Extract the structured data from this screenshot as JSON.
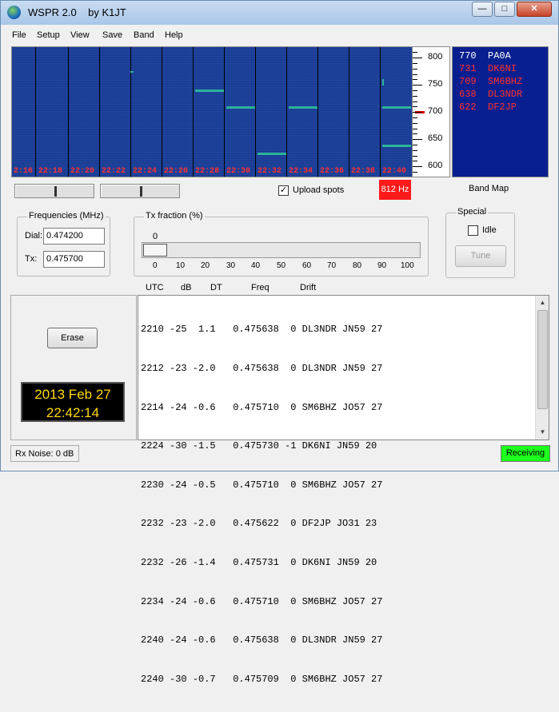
{
  "window": {
    "title": "WSPR 2.0",
    "author": "by K1JT",
    "buttons": {
      "minimize": "—",
      "maximize": "□",
      "close": "✕"
    }
  },
  "menu": [
    "File",
    "Setup",
    "View",
    "Save",
    "Band",
    "Help"
  ],
  "waterfall": {
    "times": [
      "2:16",
      "22:18",
      "22:20",
      "22:22",
      "22:24",
      "22:26",
      "22:28",
      "22:30",
      "22:32",
      "22:34",
      "22:36",
      "22:38",
      "22:40"
    ],
    "scale": {
      "ticks": [
        "800",
        "750",
        "700",
        "650",
        "600"
      ]
    },
    "signal_color": "#2fc89a",
    "marker_color": "#e00000"
  },
  "spots_panel": [
    {
      "text": "770  PA0A",
      "color": "#ffffff"
    },
    {
      "text": "731  DK6NI",
      "color": "#ff3030"
    },
    {
      "text": "709  SM6BHZ",
      "color": "#ff3030"
    },
    {
      "text": "638  DL3NDR",
      "color": "#ff3030"
    },
    {
      "text": "622  DF2JP",
      "color": "#ff3030"
    }
  ],
  "controls": {
    "upload_spots_label": "Upload spots",
    "upload_checked": "✓",
    "hz_readout": "812 Hz",
    "band_map": "Band Map"
  },
  "frequencies": {
    "title": "Frequencies (MHz)",
    "dial_label": "Dial:",
    "dial_value": "0.474200",
    "tx_label": "Tx:",
    "tx_value": "0.475700"
  },
  "tx_fraction": {
    "title": "Tx fraction (%)",
    "value": "0",
    "value_fraction": 0,
    "scale": [
      "0",
      "10",
      "20",
      "30",
      "40",
      "50",
      "60",
      "70",
      "80",
      "90",
      "100"
    ]
  },
  "special": {
    "title": "Special",
    "idle_label": "Idle",
    "tune_label": "Tune"
  },
  "erase_label": "Erase",
  "clock": {
    "date": "2013 Feb 27",
    "time": "22:42:14"
  },
  "log": {
    "headers": [
      "UTC",
      "dB",
      "DT",
      "Freq",
      "Drift"
    ],
    "lines": [
      "2210 -25  1.1   0.475638  0 DL3NDR JN59 27",
      "2212 -23 -2.0   0.475638  0 DL3NDR JN59 27",
      "2214 -24 -0.6   0.475710  0 SM6BHZ JO57 27",
      "2224 -30 -1.5   0.475730 -1 DK6NI JN59 20",
      "2230 -24 -0.5   0.475710  0 SM6BHZ JO57 27",
      "2232 -23 -2.0   0.475622  0 DF2JP JO31 23",
      "2232 -26 -1.4   0.475731  0 DK6NI JN59 20",
      "2234 -24 -0.6   0.475710  0 SM6BHZ JO57 27",
      "2240 -24 -0.6   0.475638  0 DL3NDR JN59 27",
      "2240 -30 -0.7   0.475709  0 SM6BHZ JO57 27"
    ]
  },
  "status": {
    "rx_noise": "Rx Noise: 0 dB",
    "state": "Receiving",
    "state_color": "#1cff1c"
  }
}
